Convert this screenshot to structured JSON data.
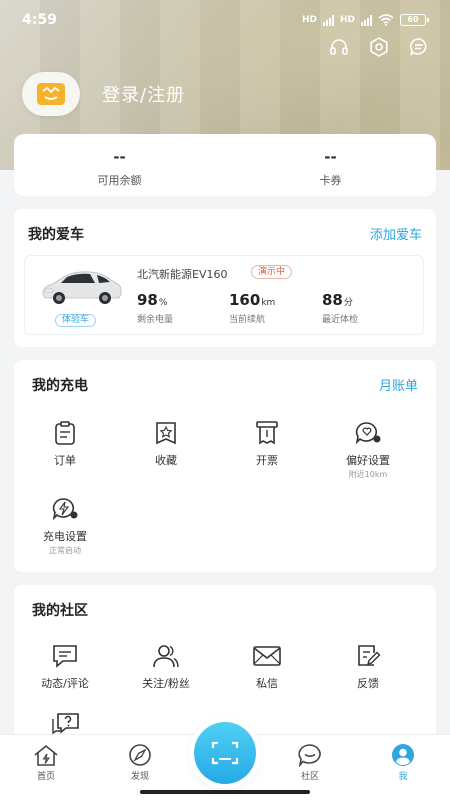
{
  "status_bar": {
    "time": "4:59",
    "network_1": "HD",
    "network_2": "HD",
    "battery": "60"
  },
  "profile": {
    "login_text": "登录/注册"
  },
  "balance": [
    {
      "value": "--",
      "label": "可用余额"
    },
    {
      "value": "--",
      "label": "卡券"
    }
  ],
  "car_section": {
    "title": "我的爱车",
    "add_link": "添加爱车",
    "car": {
      "badge": "体验车",
      "model": "北汽新能源EV160",
      "demo_tag": "演示中",
      "stats": [
        {
          "value": "98",
          "unit": "%",
          "label": "剩余电量"
        },
        {
          "value": "160",
          "unit": "km",
          "label": "当前续航"
        },
        {
          "value": "88",
          "unit": "分",
          "label": "最近体检"
        }
      ]
    }
  },
  "charge_section": {
    "title": "我的充电",
    "monthly_link": "月账单",
    "items": [
      {
        "label": "订单",
        "icon": "clipboard-icon"
      },
      {
        "label": "收藏",
        "icon": "bookmark-star-icon"
      },
      {
        "label": "开票",
        "icon": "invoice-icon"
      },
      {
        "label": "偏好设置",
        "sub": "附近10km",
        "icon": "heart-chat-icon"
      },
      {
        "label": "充电设置",
        "sub": "正常启动",
        "icon": "charge-settings-icon"
      }
    ]
  },
  "community_section": {
    "title": "我的社区",
    "items": [
      {
        "label": "动态/评论",
        "icon": "comment-icon"
      },
      {
        "label": "关注/粉丝",
        "icon": "users-icon"
      },
      {
        "label": "私信",
        "icon": "mail-icon"
      },
      {
        "label": "反馈",
        "icon": "feedback-icon"
      }
    ]
  },
  "tabbar": [
    {
      "label": "首页",
      "icon": "home-bolt-icon"
    },
    {
      "label": "发现",
      "icon": "compass-icon"
    },
    {
      "label": "社区",
      "icon": "chat-bubble-icon"
    },
    {
      "label": "我",
      "icon": "user-icon",
      "active": true
    }
  ],
  "colors": {
    "accent": "#2fa6dd",
    "demo_tag": "#e05a3a",
    "avatar": "#f6b22a"
  }
}
